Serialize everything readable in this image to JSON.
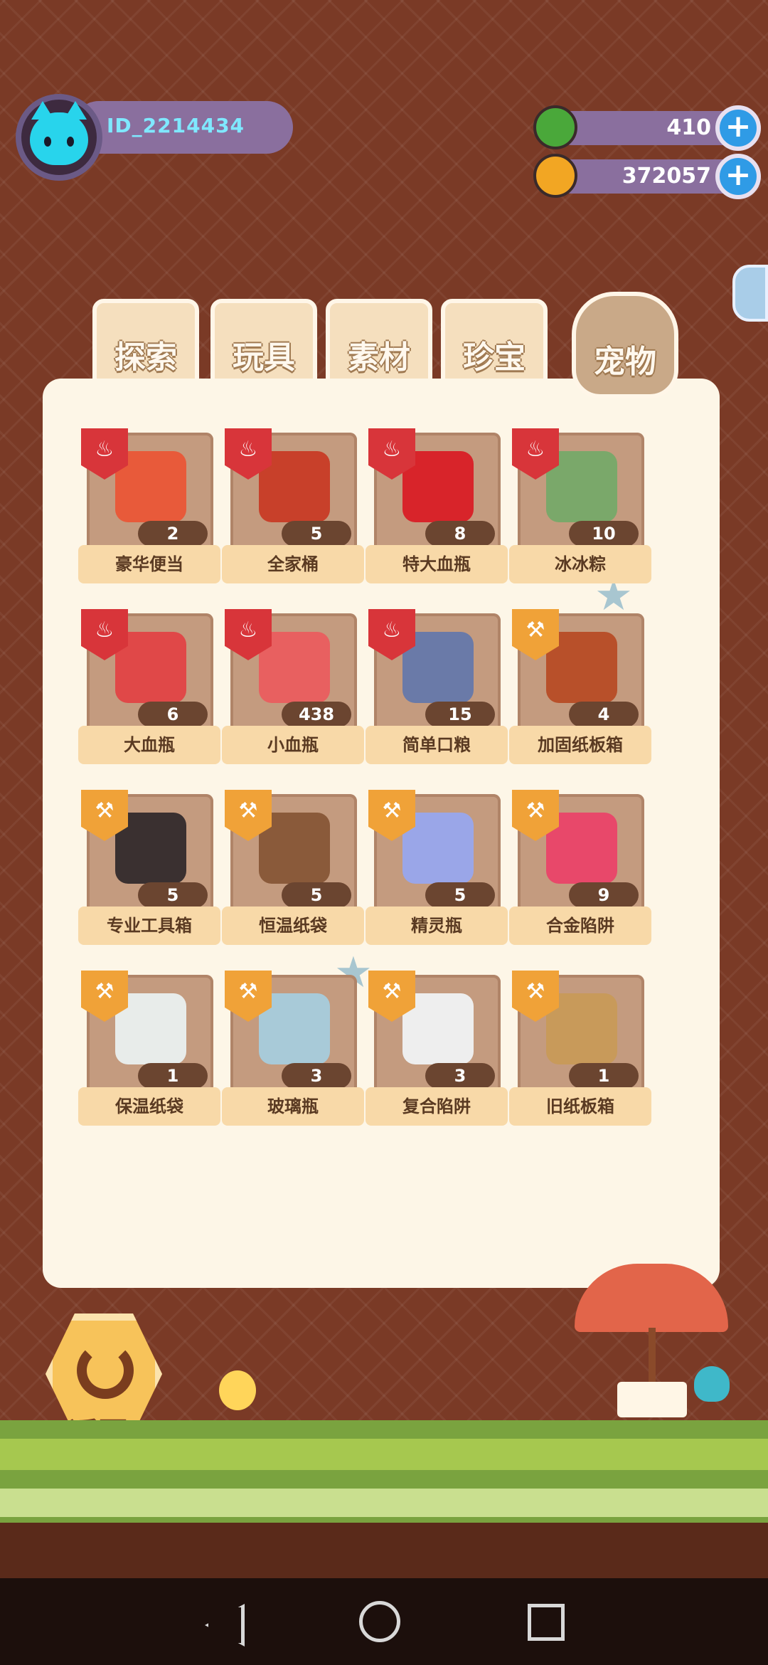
{
  "profile": {
    "id_text": "ID_2214434"
  },
  "currency": [
    {
      "value": "410",
      "icon": "green-gem-icon",
      "color": "#4aa83a"
    },
    {
      "value": "372057",
      "icon": "gold-planet-coin-icon",
      "color": "#f2a623"
    }
  ],
  "tabs": [
    {
      "label": "探索",
      "active": false
    },
    {
      "label": "玩具",
      "active": false
    },
    {
      "label": "素材",
      "active": false
    },
    {
      "label": "珍宝",
      "active": false
    },
    {
      "label": "宠物",
      "active": true
    }
  ],
  "items": [
    {
      "name": "豪华便当",
      "count": "2",
      "badge": "food",
      "color": "#e85a3a"
    },
    {
      "name": "全家桶",
      "count": "5",
      "badge": "food",
      "color": "#c8402a"
    },
    {
      "name": "特大血瓶",
      "count": "8",
      "badge": "food",
      "color": "#d8242a"
    },
    {
      "name": "冰冰粽",
      "count": "10",
      "badge": "food",
      "color": "#7aa86a"
    },
    {
      "name": "大血瓶",
      "count": "6",
      "badge": "food",
      "color": "#e04848"
    },
    {
      "name": "小血瓶",
      "count": "438",
      "badge": "food",
      "color": "#e86060"
    },
    {
      "name": "简单口粮",
      "count": "15",
      "badge": "food",
      "color": "#6a7aa8"
    },
    {
      "name": "加固纸板箱",
      "count": "4",
      "badge": "tool",
      "color": "#b8502a"
    },
    {
      "name": "专业工具箱",
      "count": "5",
      "badge": "tool",
      "color": "#3a3030"
    },
    {
      "name": "恒温纸袋",
      "count": "5",
      "badge": "tool",
      "color": "#8a5a3a"
    },
    {
      "name": "精灵瓶",
      "count": "5",
      "badge": "tool",
      "color": "#9aa6e8"
    },
    {
      "name": "合金陷阱",
      "count": "9",
      "badge": "tool",
      "color": "#e8486a"
    },
    {
      "name": "保温纸袋",
      "count": "1",
      "badge": "tool",
      "color": "#e8ecea"
    },
    {
      "name": "玻璃瓶",
      "count": "3",
      "badge": "tool",
      "color": "#a8cad8"
    },
    {
      "name": "复合陷阱",
      "count": "3",
      "badge": "tool",
      "color": "#eeeeee"
    },
    {
      "name": "旧纸板箱",
      "count": "1",
      "badge": "tool",
      "color": "#c89a5a"
    }
  ],
  "badge_colors": {
    "food": "#d8353a",
    "tool": "#f0a238"
  },
  "back": {
    "label": "返回"
  }
}
